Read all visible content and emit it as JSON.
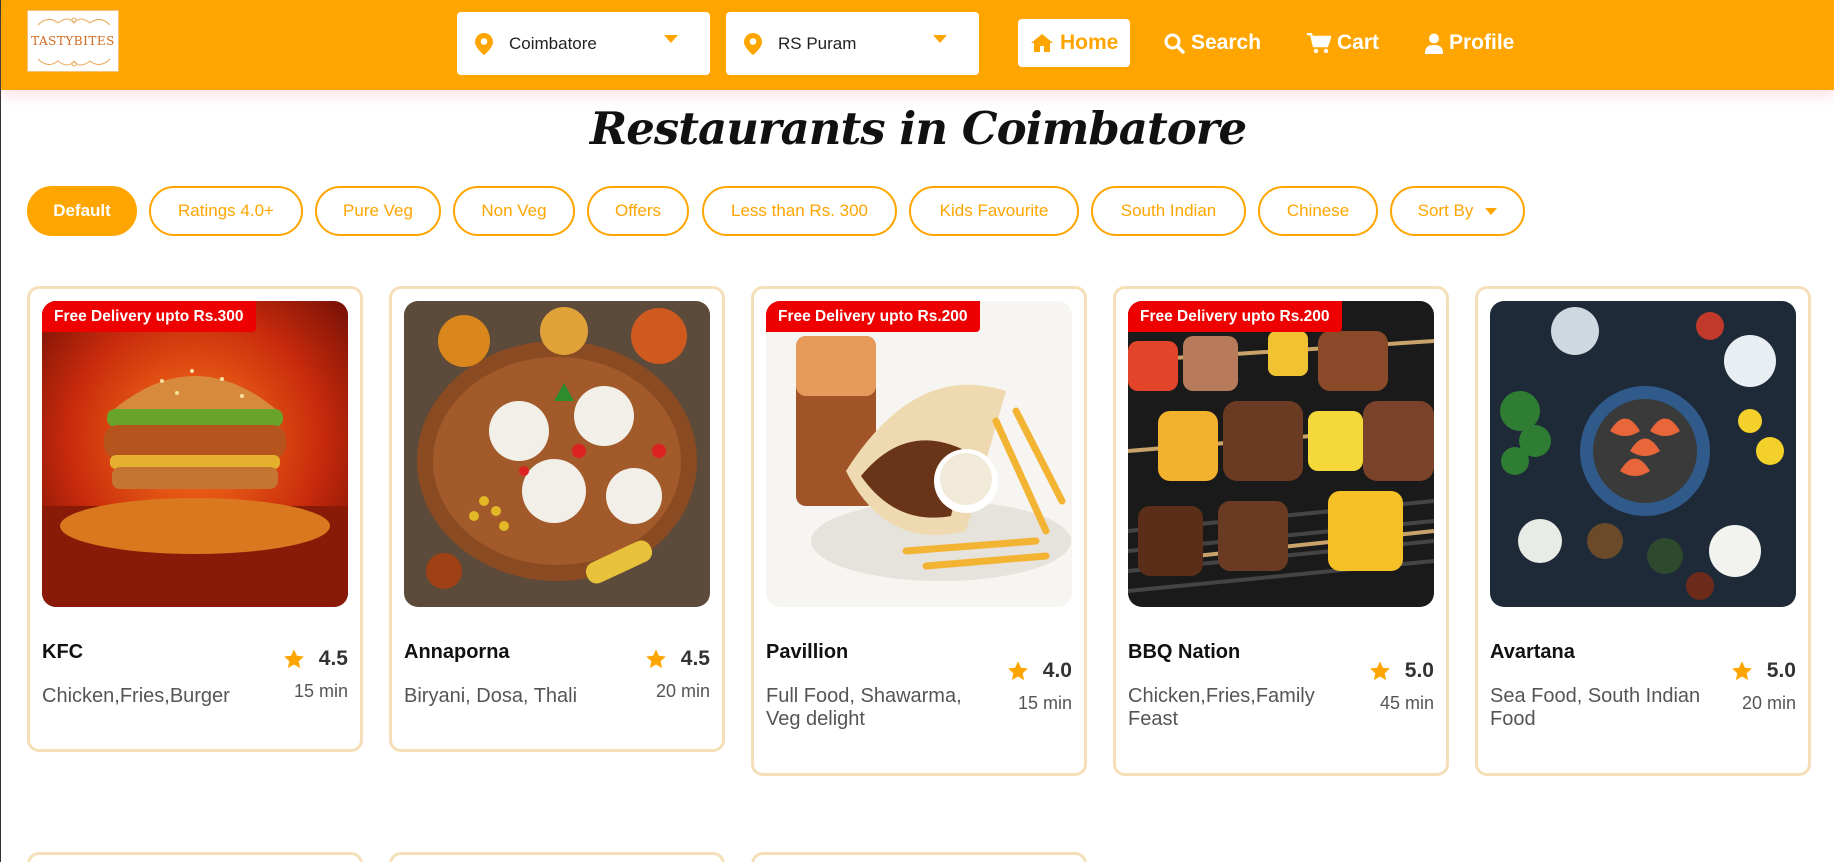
{
  "header": {
    "logo_text": "TASTYBITES",
    "city": "Coimbatore",
    "area": "RS Puram",
    "nav": {
      "home": "Home",
      "search": "Search",
      "cart": "Cart",
      "profile": "Profile"
    },
    "accent_color": "#FFA500"
  },
  "page_title": "Restaurants in Coimbatore",
  "filters": [
    "Default",
    "Ratings 4.0+",
    "Pure Veg",
    "Non Veg",
    "Offers",
    "Less than Rs. 300",
    "Kids Favourite",
    "South Indian",
    "Chinese",
    "Sort By"
  ],
  "restaurants": [
    {
      "name": "KFC",
      "cuisine": "Chicken,Fries,Burger",
      "rating": "4.5",
      "time": "15 min",
      "offer": "Free Delivery upto Rs.300",
      "image": "burger-image"
    },
    {
      "name": "Annaporna",
      "cuisine": "Biryani, Dosa, Thali",
      "rating": "4.5",
      "time": "20 min",
      "offer": "",
      "image": "idli-platter-image"
    },
    {
      "name": "Pavillion",
      "cuisine": "Full Food, Shawarma, Veg delight",
      "rating": "4.0",
      "time": "15 min",
      "offer": "Free Delivery upto Rs.200",
      "image": "shawarma-image"
    },
    {
      "name": "BBQ Nation",
      "cuisine": "Chicken,Fries,Family Feast",
      "rating": "5.0",
      "time": "45 min",
      "offer": "Free Delivery upto Rs.200",
      "image": "bbq-skewers-image"
    },
    {
      "name": "Avartana",
      "cuisine": "Sea Food, South Indian Food",
      "rating": "5.0",
      "time": "20 min",
      "offer": "",
      "image": "seafood-spread-image"
    }
  ]
}
